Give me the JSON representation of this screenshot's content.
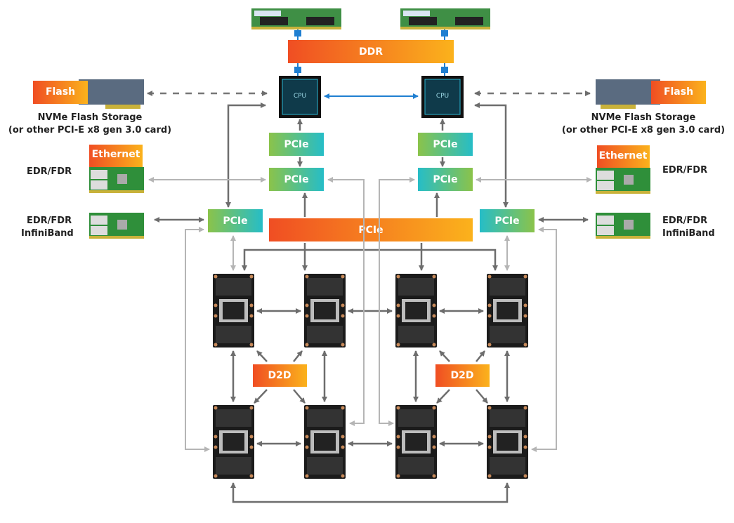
{
  "labels": {
    "ddr": "DDR",
    "cpu": "CPU",
    "pcie": "PCIe",
    "d2d": "D2D",
    "flash": "Flash",
    "ethernet": "Ethernet",
    "nvme_line1": "NVMe Flash Storage",
    "nvme_line2": "(or other PCI-E x8 gen 3.0 card)",
    "edr_fdr": "EDR/FDR",
    "infiniband": "InfiniBand"
  },
  "colors": {
    "orange_start": "#f04e23",
    "orange_end": "#fbb21c",
    "green_start": "#8bc34a",
    "teal_end": "#26bdc7",
    "arrow_dark": "#6d6d6d",
    "arrow_light": "#b5b5b5",
    "cpu_link": "#1f7fd1"
  }
}
